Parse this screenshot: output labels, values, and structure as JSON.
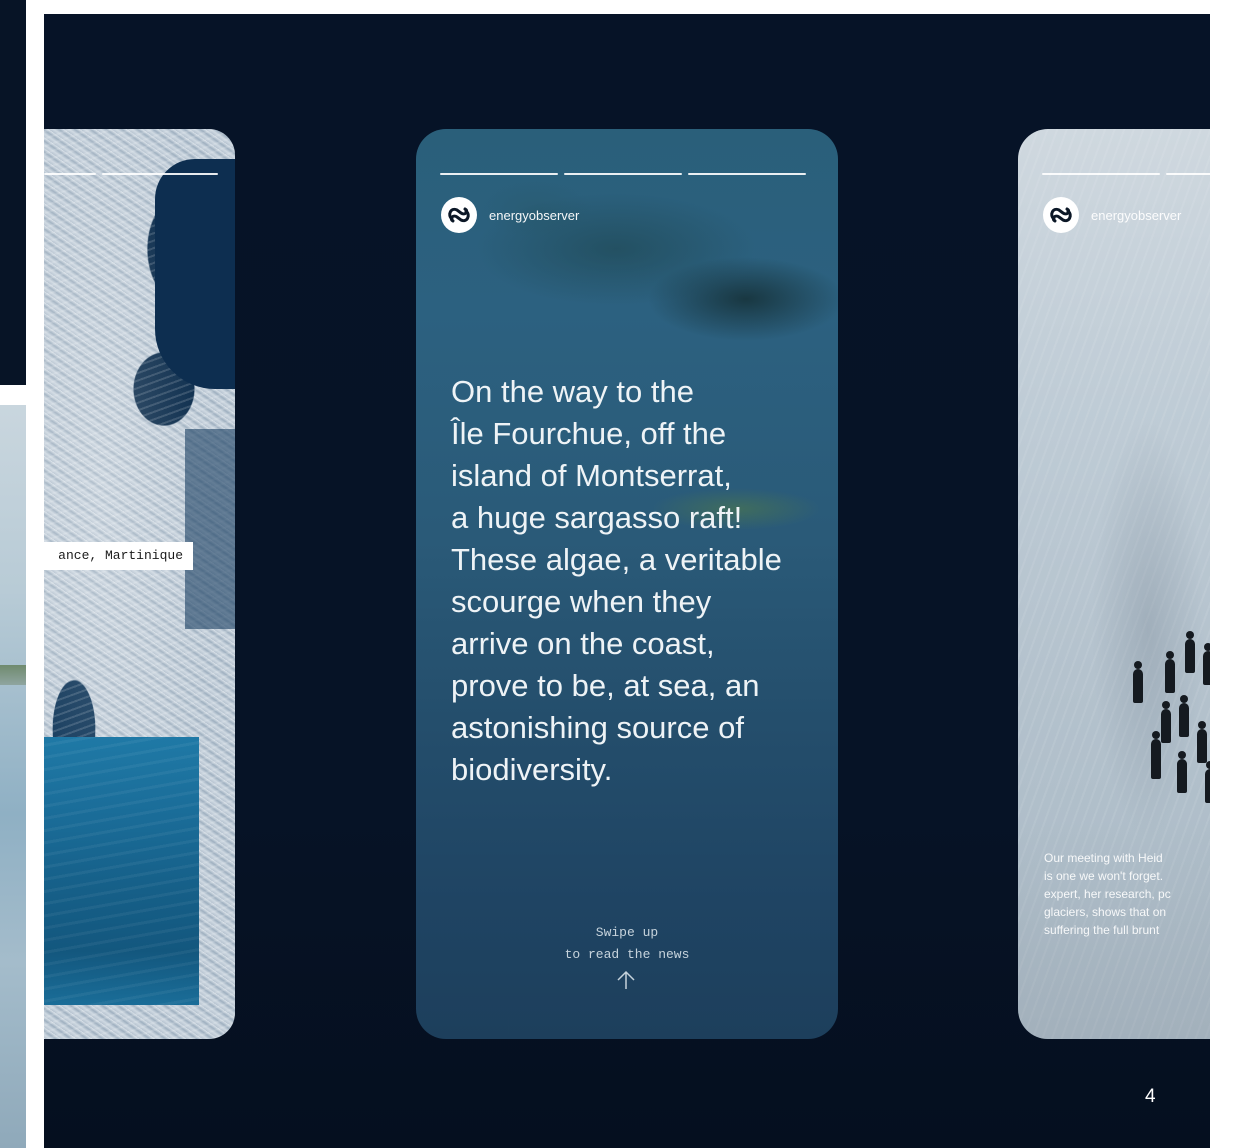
{
  "stories": {
    "left": {
      "location_label": "ance, Martinique"
    },
    "center": {
      "account": "energyobserver",
      "text": "On the way to the\nÎle Fourchue, off the\nisland of Montserrat,\na huge sargasso raft!\nThese algae, a veritable\nscourge when they\narrive on the coast,\nprove to be, at sea, an\nastonishing source of\nbiodiversity.",
      "swipe_text": "Swipe up\nto read the news",
      "swipe_icon": "arrow-up-icon"
    },
    "right": {
      "account": "energyobserver",
      "caption": "Our meeting with Heid\nis one we won't forget.\nexpert, her research, pc\nglaciers, shows that on\nsuffering the full brunt"
    }
  },
  "page_number": "4",
  "colors": {
    "stage_background": "#061327",
    "text": "#ffffff",
    "label_background": "#ffffff"
  }
}
